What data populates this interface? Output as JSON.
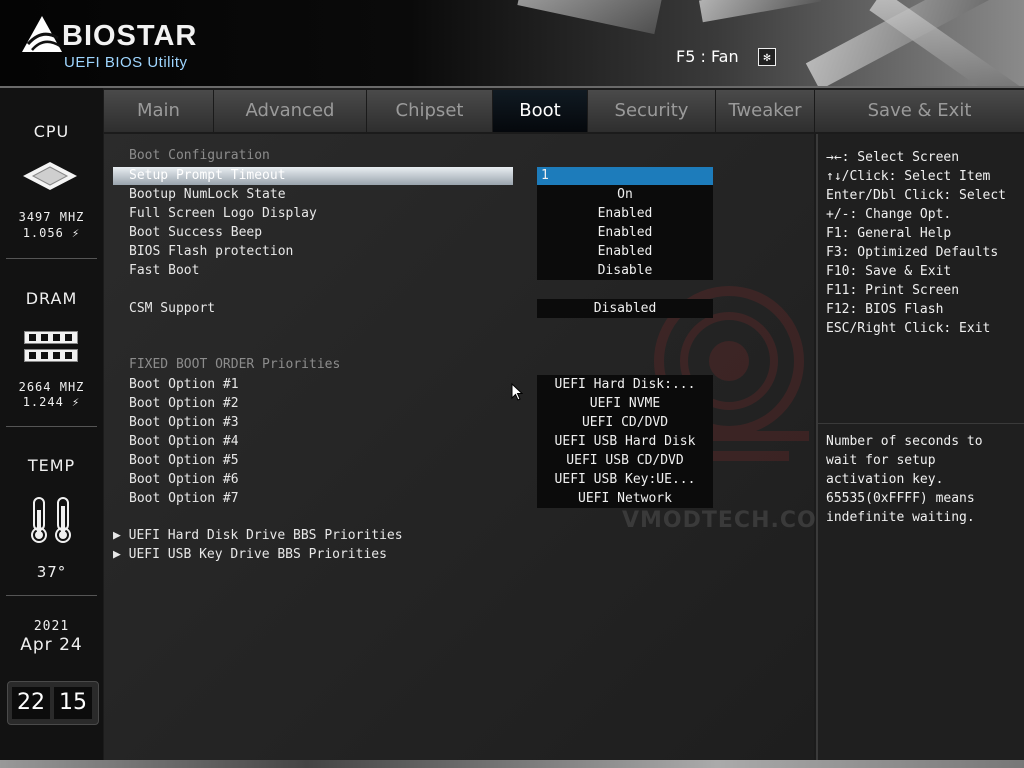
{
  "header": {
    "brand": "BIOSTAR",
    "subtitle": "UEFI BIOS Utility",
    "fan_label": "F5 : Fan",
    "fan_icon": "fan-icon"
  },
  "left_panel": {
    "cpu": {
      "title": "CPU",
      "freq": "3497 MHZ",
      "volt": "1.056 ⚡"
    },
    "dram": {
      "title": "DRAM",
      "freq": "2664 MHZ",
      "volt": "1.244 ⚡"
    },
    "temp": {
      "title": "TEMP",
      "value": "37°"
    },
    "date": {
      "year": "2021",
      "monthday": "Apr 24"
    },
    "time": {
      "hour": "22",
      "minute": "15"
    }
  },
  "tabs": [
    {
      "label": "Main"
    },
    {
      "label": "Advanced"
    },
    {
      "label": "Chipset"
    },
    {
      "label": "Boot",
      "active": true
    },
    {
      "label": "Security"
    },
    {
      "label": "Tweaker"
    },
    {
      "label": "Save & Exit"
    }
  ],
  "boot": {
    "section_config": "Boot Configuration",
    "settings": [
      {
        "label": "Setup Prompt Timeout",
        "value": "1",
        "selected": true
      },
      {
        "label": "Bootup NumLock State",
        "value": "On"
      },
      {
        "label": "Full Screen Logo Display",
        "value": "Enabled"
      },
      {
        "label": "Boot Success Beep",
        "value": "Enabled"
      },
      {
        "label": "BIOS Flash protection",
        "value": "Enabled"
      },
      {
        "label": "Fast Boot",
        "value": "Disable"
      }
    ],
    "csm": {
      "label": "CSM Support",
      "value": "Disabled"
    },
    "section_order": "FIXED BOOT ORDER Priorities",
    "boot_options": [
      {
        "label": "Boot Option #1",
        "value": "UEFI Hard Disk:..."
      },
      {
        "label": "Boot Option #2",
        "value": "UEFI NVME"
      },
      {
        "label": "Boot Option #3",
        "value": "UEFI CD/DVD"
      },
      {
        "label": "Boot Option #4",
        "value": "UEFI USB Hard Disk"
      },
      {
        "label": "Boot Option #5",
        "value": "UEFI USB CD/DVD"
      },
      {
        "label": "Boot Option #6",
        "value": "UEFI USB Key:UE..."
      },
      {
        "label": "Boot Option #7",
        "value": "UEFI Network"
      }
    ],
    "submenus": [
      {
        "label": "▶  UEFI Hard Disk Drive BBS Priorities"
      },
      {
        "label": "▶  UEFI USB Key Drive BBS Priorities"
      }
    ],
    "watermark": "VMODTECH.COM"
  },
  "keys": [
    "→←: Select Screen",
    "↑↓/Click: Select Item",
    "Enter/Dbl Click: Select",
    "+/-: Change Opt.",
    "F1: General Help",
    "F3: Optimized Defaults",
    "F10: Save & Exit",
    "F11: Print Screen",
    "F12: BIOS Flash",
    "ESC/Right Click: Exit"
  ],
  "help_text": "Number of seconds to wait for setup activation key. 65535(0xFFFF) means indefinite waiting."
}
